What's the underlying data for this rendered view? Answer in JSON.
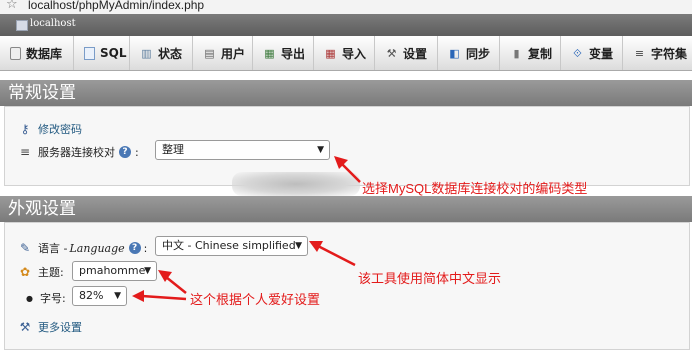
{
  "browser": {
    "url": "localhost/phpMyAdmin/index.php"
  },
  "server": {
    "name": "localhost"
  },
  "tabs": [
    {
      "label": "数据库",
      "icon": "database-icon"
    },
    {
      "label": "SQL",
      "icon": "sql-icon"
    },
    {
      "label": "状态",
      "icon": "status-icon"
    },
    {
      "label": "用户",
      "icon": "users-icon"
    },
    {
      "label": "导出",
      "icon": "export-icon"
    },
    {
      "label": "导入",
      "icon": "import-icon"
    },
    {
      "label": "设置",
      "icon": "wrench-icon"
    },
    {
      "label": "同步",
      "icon": "sync-icon"
    },
    {
      "label": "复制",
      "icon": "replication-icon"
    },
    {
      "label": "变量",
      "icon": "variables-icon"
    },
    {
      "label": "字符集",
      "icon": "charset-icon"
    }
  ],
  "general": {
    "title": "常规设置",
    "change_password": "修改密码",
    "collation_label": "服务器连接校对",
    "collation_value": "整理",
    "annotation": "选择MySQL数据库连接校对的编码类型"
  },
  "appearance": {
    "title": "外观设置",
    "language_label": "语言 - ",
    "language_italic": "Language",
    "language_value": "中文 - Chinese simplified",
    "language_annotation": "该工具使用简体中文显示",
    "theme_label": "主题:",
    "theme_value": "pmahomme",
    "font_label": "字号:",
    "font_value": "82%",
    "pref_annotation": "这个根据个人爱好设置",
    "more_settings": "更多设置"
  },
  "colors": {
    "annotation_red": "#e31b1b",
    "link_blue": "#235a81"
  }
}
